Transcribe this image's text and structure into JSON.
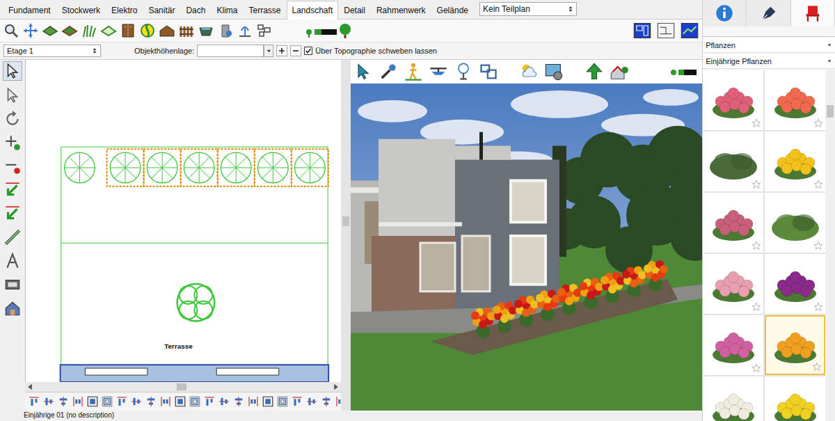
{
  "tabs": [
    {
      "label": "Fundament",
      "selected": false
    },
    {
      "label": "Stockwerk",
      "selected": false
    },
    {
      "label": "Elektro",
      "selected": false
    },
    {
      "label": "Sanitär",
      "selected": false
    },
    {
      "label": "Dach",
      "selected": false
    },
    {
      "label": "Klima",
      "selected": false
    },
    {
      "label": "Terrasse",
      "selected": false
    },
    {
      "label": "Landschaft",
      "selected": true
    },
    {
      "label": "Detail",
      "selected": false
    },
    {
      "label": "Rahmenwerk",
      "selected": false
    },
    {
      "label": "Gelände",
      "selected": false
    }
  ],
  "plan_selector": {
    "value": "Kein Teilplan"
  },
  "panel_tabs": [
    {
      "kind": "info",
      "selected": false
    },
    {
      "kind": "style",
      "selected": false
    },
    {
      "kind": "furniture",
      "selected": true
    }
  ],
  "floor": {
    "value": "Etage 1"
  },
  "height_field": {
    "label": "Objekthöhenlage:",
    "value": ""
  },
  "float_checkbox": {
    "label": "Über Topographie schweben lassen",
    "checked": true
  },
  "library": {
    "category": "Pflanzen",
    "subcategory": "Einjährige Pflanzen",
    "items": [
      {
        "kind": "flower",
        "color": "#e0607a",
        "selected": false,
        "starred": false
      },
      {
        "kind": "flower",
        "color": "#f06a50",
        "selected": false,
        "starred": false
      },
      {
        "kind": "shrub",
        "color": "#4a6a3a",
        "selected": false,
        "starred": false
      },
      {
        "kind": "flower",
        "color": "#f2c21a",
        "selected": false,
        "starred": false
      },
      {
        "kind": "flower",
        "color": "#c8607a",
        "selected": false,
        "starred": false
      },
      {
        "kind": "shrub",
        "color": "#5a8a3a",
        "selected": false,
        "starred": false
      },
      {
        "kind": "flower",
        "color": "#e8a0b0",
        "selected": false,
        "starred": false
      },
      {
        "kind": "flower",
        "color": "#8a2a8a",
        "selected": false,
        "starred": false
      },
      {
        "kind": "flower",
        "color": "#d060a0",
        "selected": false,
        "starred": false
      },
      {
        "kind": "flower",
        "color": "#f0a020",
        "selected": true,
        "starred": false
      },
      {
        "kind": "flower",
        "color": "#f0ece0",
        "selected": false,
        "starred": false
      },
      {
        "kind": "flower",
        "color": "#f0d020",
        "selected": false,
        "starred": false
      }
    ]
  },
  "plan": {
    "label": "Terrasse",
    "plants": [
      {
        "selected": false
      },
      {
        "selected": true
      },
      {
        "selected": true
      },
      {
        "selected": true
      },
      {
        "selected": true
      },
      {
        "selected": true
      },
      {
        "selected": true
      }
    ]
  },
  "status_bar": {
    "text": "Einjährige 01 (no description)"
  }
}
